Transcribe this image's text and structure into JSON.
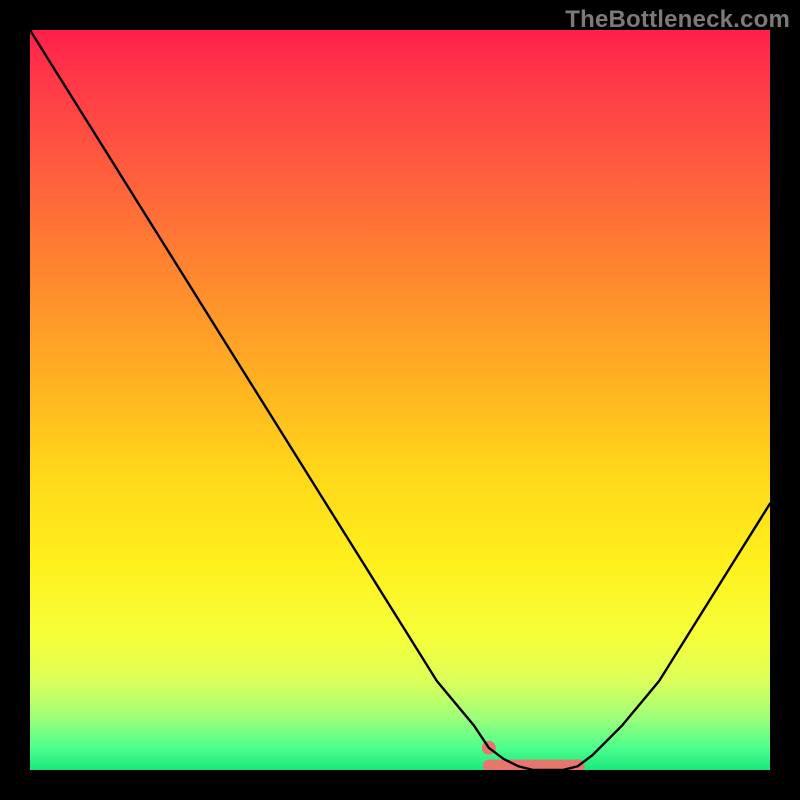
{
  "watermark": "TheBottleneck.com",
  "colors": {
    "background": "#000000",
    "curve": "#000000",
    "optimum_band": "#e6776f",
    "watermark": "#7a7a7a"
  },
  "chart_data": {
    "type": "line",
    "x": [
      0,
      5,
      10,
      15,
      20,
      25,
      30,
      35,
      40,
      45,
      50,
      55,
      60,
      62,
      64,
      66,
      68,
      70,
      72,
      74,
      76,
      80,
      85,
      90,
      95,
      100
    ],
    "values": [
      100,
      92,
      84,
      76,
      68,
      60,
      52,
      44,
      36,
      28,
      20,
      12,
      6,
      3,
      1.5,
      0.5,
      0,
      0,
      0,
      0.5,
      2,
      6,
      12,
      20,
      28,
      36
    ],
    "title": "",
    "xlabel": "",
    "ylabel": "",
    "xlim": [
      0,
      100
    ],
    "ylim": [
      0,
      100
    ],
    "optimum_range_x": [
      62,
      74
    ],
    "annotations": [
      {
        "text": "TheBottleneck.com",
        "role": "watermark"
      }
    ]
  }
}
